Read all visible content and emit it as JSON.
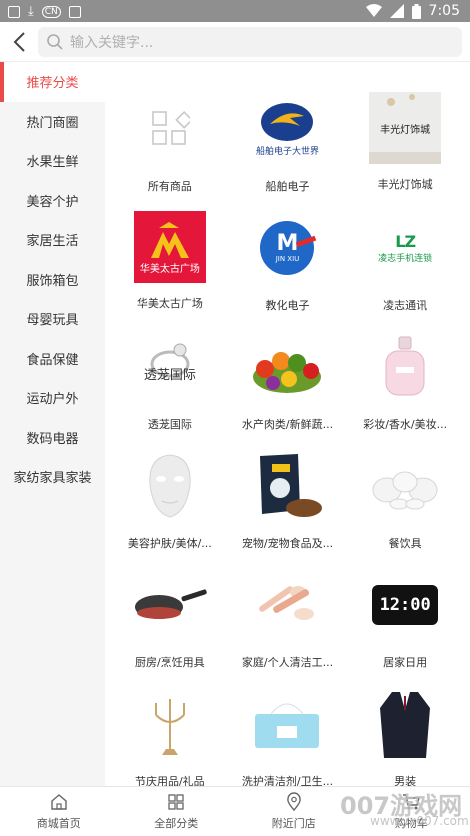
{
  "status_bar": {
    "time": "7:05"
  },
  "search": {
    "placeholder": "输入关键字..."
  },
  "sidebar": {
    "items": [
      {
        "label": "推荐分类",
        "active": true
      },
      {
        "label": "热门商圈"
      },
      {
        "label": "水果生鲜"
      },
      {
        "label": "美容个护"
      },
      {
        "label": "家居生活"
      },
      {
        "label": "服饰箱包"
      },
      {
        "label": "母婴玩具"
      },
      {
        "label": "食品保健"
      },
      {
        "label": "运动户外"
      },
      {
        "label": "数码电器"
      },
      {
        "label": "家纺家具家装"
      }
    ]
  },
  "categories": [
    {
      "label": "所有商品",
      "icon": "all-products-icon"
    },
    {
      "label": "船舶电子",
      "icon": "ship-electronics-logo",
      "logo_text": "船舶电子大世界"
    },
    {
      "label": "丰光灯饰城",
      "icon": "lighting-store-image",
      "logo_text": "丰光灯饰城"
    },
    {
      "label": "华美太古广场",
      "icon": "huamei-logo",
      "logo_text": "华美太古广场"
    },
    {
      "label": "教化电子",
      "icon": "jinxiu-logo",
      "logo_text": "JIN XIU"
    },
    {
      "label": "凌志通讯",
      "icon": "lingzhi-logo",
      "logo_text": "凌志手机连锁"
    },
    {
      "label": "透茏国际",
      "icon": "ring-image",
      "logo_text": "透茏国际"
    },
    {
      "label": "水产肉类/新鲜蔬...",
      "icon": "vegetables-image"
    },
    {
      "label": "彩妆/香水/美妆...",
      "icon": "perfume-image"
    },
    {
      "label": "美容护肤/美体/...",
      "icon": "face-mask-image"
    },
    {
      "label": "宠物/宠物食品及...",
      "icon": "pet-food-image"
    },
    {
      "label": "餐饮具",
      "icon": "tableware-image"
    },
    {
      "label": "厨房/烹饪用具",
      "icon": "frying-pan-image"
    },
    {
      "label": "家庭/个人清洁工...",
      "icon": "cleaning-brush-image"
    },
    {
      "label": "居家日用",
      "icon": "clock-image",
      "logo_text": "12:00"
    },
    {
      "label": "节庆用品/礼品",
      "icon": "candelabra-image"
    },
    {
      "label": "洗护清洁剂/卫生...",
      "icon": "tissue-image"
    },
    {
      "label": "男装",
      "icon": "suit-image"
    }
  ],
  "tabbar": {
    "items": [
      {
        "label": "商城首页",
        "icon": "home-icon"
      },
      {
        "label": "全部分类",
        "icon": "grid-icon"
      },
      {
        "label": "附近门店",
        "icon": "location-icon"
      },
      {
        "label": "购物车",
        "icon": "cart-icon"
      }
    ]
  },
  "watermark": {
    "brand": "007游戏网",
    "url": "www.yx007.com"
  },
  "colors": {
    "accent": "#e94b4b",
    "statusbar": "#8f8f8f",
    "sidebar_bg": "#f5f5f5"
  }
}
